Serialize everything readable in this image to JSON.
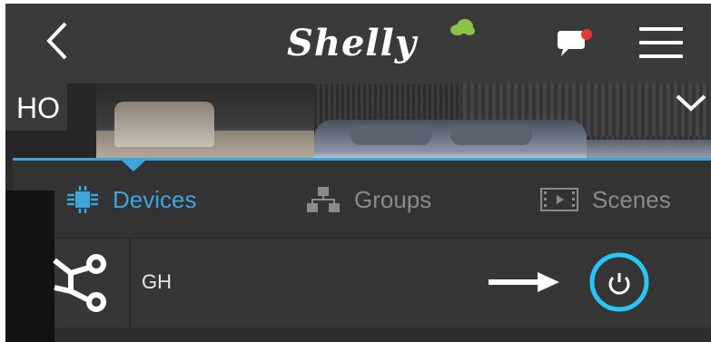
{
  "header": {
    "logo_text": "Shelly",
    "back_icon": "chevron-left-icon",
    "chat_icon": "chat-notification-icon",
    "menu_icon": "hamburger-menu-icon",
    "notification_color": "#e53935"
  },
  "room": {
    "name": "HO",
    "expand_icon": "chevron-down-icon"
  },
  "tabs": [
    {
      "label": "Devices",
      "icon": "chip-icon",
      "active": true
    },
    {
      "label": "Groups",
      "icon": "groups-icon",
      "active": false
    },
    {
      "label": "Scenes",
      "icon": "scenes-icon",
      "active": false
    }
  ],
  "devices": [
    {
      "name": "GH",
      "icon": "network-nodes-icon",
      "power_icon": "power-icon",
      "state": "off"
    }
  ],
  "colors": {
    "accent": "#3aa6dc",
    "power_ring": "#29c5f6",
    "header_bg": "#3a3a3a"
  },
  "annotation": {
    "icon": "arrow-right-icon",
    "color": "#ffffff"
  }
}
